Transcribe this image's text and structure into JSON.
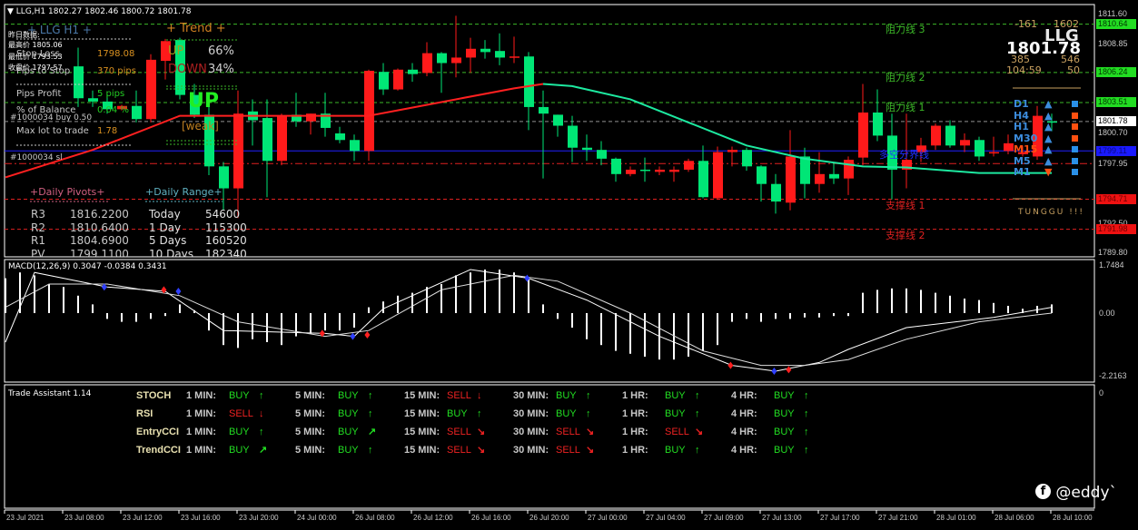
{
  "header": {
    "title": "LLG,H1",
    "ohlc": "1802.27 1802.46 1800.72 1801.78"
  },
  "colors": {
    "bull": "#00e676",
    "bear": "#ff1a1a",
    "ma_up": "#ff2020",
    "ma_down": "#1de9a0",
    "green_level": "#3cb828",
    "red_level": "#e02020",
    "blue_level": "#2020ff",
    "gray_level": "#909090"
  },
  "candles": [
    [
      1803.9,
      1808.5,
      1803.1,
      1806.8
    ],
    [
      1803.6,
      1804.6,
      1803.1,
      1803.9
    ],
    [
      1802.9,
      1804.2,
      1802.5,
      1803.6
    ],
    [
      1803.2,
      1803.3,
      1802.8,
      1802.9
    ],
    [
      1802.0,
      1804.6,
      1801.7,
      1803.2
    ],
    [
      1807.4,
      1807.9,
      1801.7,
      1802.0
    ],
    [
      1809.1,
      1809.3,
      1805.6,
      1807.3
    ],
    [
      1804.2,
      1809.4,
      1803.8,
      1809.2
    ],
    [
      1802.4,
      1805.2,
      1802.1,
      1804.2
    ],
    [
      1797.7,
      1804.0,
      1796.9,
      1802.4
    ],
    [
      1795.7,
      1798.1,
      1793.7,
      1797.7
    ],
    [
      1802.5,
      1804.6,
      1793.0,
      1795.7
    ],
    [
      1801.9,
      1803.8,
      1799.6,
      1802.7
    ],
    [
      1798.2,
      1803.8,
      1794.9,
      1802.1
    ],
    [
      1802.3,
      1802.5,
      1797.8,
      1798.2
    ],
    [
      1801.8,
      1804.4,
      1801.3,
      1802.4
    ],
    [
      1802.5,
      1802.5,
      1800.6,
      1801.8
    ],
    [
      1801.2,
      1804.4,
      1800.4,
      1802.5
    ],
    [
      1800.1,
      1801.3,
      1799.8,
      1800.7
    ],
    [
      1799.1,
      1800.6,
      1798.2,
      1800.1
    ],
    [
      1806.4,
      1806.5,
      1798.2,
      1799.1
    ],
    [
      1804.7,
      1807.1,
      1804.2,
      1806.3
    ],
    [
      1806.5,
      1806.6,
      1804.6,
      1804.7
    ],
    [
      1806.1,
      1807.1,
      1805.4,
      1806.5
    ],
    [
      1808.0,
      1809.0,
      1805.9,
      1806.2
    ],
    [
      1807.1,
      1808.1,
      1804.4,
      1808.0
    ],
    [
      1807.6,
      1811.4,
      1805.8,
      1807.1
    ],
    [
      1808.4,
      1809.4,
      1806.2,
      1807.6
    ],
    [
      1808.1,
      1809.2,
      1807.5,
      1808.4
    ],
    [
      1807.6,
      1809.8,
      1806.9,
      1808.2
    ],
    [
      1807.7,
      1809.5,
      1807.1,
      1807.6
    ],
    [
      1803.1,
      1808.1,
      1801.0,
      1807.7
    ],
    [
      1802.5,
      1804.6,
      1796.6,
      1803.1
    ],
    [
      1801.4,
      1802.4,
      1800.4,
      1802.4
    ],
    [
      1799.4,
      1802.3,
      1798.1,
      1801.4
    ],
    [
      1799.2,
      1800.6,
      1798.2,
      1799.4
    ],
    [
      1798.4,
      1800.0,
      1797.8,
      1799.2
    ],
    [
      1797.0,
      1798.5,
      1796.3,
      1798.4
    ],
    [
      1797.4,
      1797.7,
      1796.8,
      1797.0
    ],
    [
      1797.3,
      1798.5,
      1796.3,
      1797.4
    ],
    [
      1797.4,
      1797.7,
      1796.9,
      1797.2
    ],
    [
      1797.4,
      1797.7,
      1796.3,
      1797.2
    ],
    [
      1798.2,
      1798.4,
      1797.2,
      1797.4
    ],
    [
      1794.9,
      1799.6,
      1794.8,
      1798.2
    ],
    [
      1799.0,
      1799.5,
      1794.7,
      1794.8
    ],
    [
      1799.2,
      1799.5,
      1797.7,
      1799.0
    ],
    [
      1797.7,
      1799.4,
      1797.3,
      1799.2
    ],
    [
      1796.1,
      1797.8,
      1794.5,
      1797.7
    ],
    [
      1794.5,
      1797.0,
      1793.4,
      1796.1
    ],
    [
      1798.6,
      1801.0,
      1793.7,
      1794.4
    ],
    [
      1796.1,
      1799.4,
      1794.8,
      1798.6
    ],
    [
      1797.0,
      1799.0,
      1795.3,
      1796.1
    ],
    [
      1796.6,
      1798.0,
      1796.1,
      1797.0
    ],
    [
      1798.3,
      1798.6,
      1795.1,
      1796.6
    ],
    [
      1802.6,
      1805.2,
      1797.8,
      1798.5
    ],
    [
      1800.5,
      1804.7,
      1800.0,
      1802.6
    ],
    [
      1797.4,
      1802.5,
      1794.7,
      1800.5
    ],
    [
      1798.3,
      1802.5,
      1795.7,
      1797.4
    ],
    [
      1799.6,
      1800.3,
      1798.1,
      1799.0
    ],
    [
      1801.4,
      1801.6,
      1799.2,
      1799.6
    ],
    [
      1799.6,
      1801.9,
      1799.4,
      1801.4
    ],
    [
      1800.1,
      1800.7,
      1799.0,
      1799.6
    ],
    [
      1798.6,
      1800.4,
      1798.2,
      1800.1
    ],
    [
      1799.0,
      1800.4,
      1798.6,
      1798.9
    ],
    [
      1799.8,
      1800.6,
      1798.8,
      1799.1
    ],
    [
      1799.0,
      1799.6,
      1798.6,
      1798.8
    ],
    [
      1802.3,
      1803.2,
      1798.3,
      1798.6
    ],
    [
      1801.7,
      1802.5,
      1800.9,
      1801.8
    ]
  ],
  "ma": [
    [
      -5,
      1796.7
    ],
    [
      1,
      1799.2
    ],
    [
      7,
      1802.3
    ],
    [
      13,
      1802.3
    ],
    [
      20,
      1802.3
    ],
    [
      26,
      1803.8
    ],
    [
      30,
      1804.8
    ],
    [
      32,
      1805.2
    ],
    [
      34,
      1805.0
    ],
    [
      38,
      1803.8
    ],
    [
      42,
      1801.7
    ],
    [
      46,
      1799.6
    ],
    [
      50,
      1798.4
    ],
    [
      54,
      1797.7
    ],
    [
      57,
      1797.6
    ],
    [
      62,
      1797.1
    ],
    [
      67,
      1797.1
    ]
  ],
  "ma_turn_index": 33,
  "levels": [
    {
      "price": 1810.64,
      "color": "#3cb828",
      "style": "dash"
    },
    {
      "price": 1806.24,
      "color": "#3cb828",
      "style": "dash"
    },
    {
      "price": 1803.51,
      "color": "#3cb828",
      "style": "dash"
    },
    {
      "price": 1801.78,
      "color": "#909090",
      "style": "dash"
    },
    {
      "price": 1799.11,
      "color": "#2020ff",
      "style": "solid"
    },
    {
      "price": 1797.95,
      "color": "#e02020",
      "style": "dashdot"
    },
    {
      "price": 1794.71,
      "color": "#e02020",
      "style": "dash"
    },
    {
      "price": 1791.98,
      "color": "#e02020",
      "style": "dash"
    }
  ],
  "price_axis": [
    {
      "text": "1811.60",
      "price": 1811.6,
      "bg": "",
      "fg": "#c8c8c8"
    },
    {
      "text": "1810.64",
      "price": 1810.64,
      "bg": "#22dd22",
      "fg": "#003300"
    },
    {
      "text": "1808.85",
      "price": 1808.85,
      "bg": "",
      "fg": "#c8c8c8"
    },
    {
      "text": "1806.24",
      "price": 1806.24,
      "bg": "#22dd22",
      "fg": "#003300"
    },
    {
      "text": "1803.51",
      "price": 1803.51,
      "bg": "#22dd22",
      "fg": "#003300"
    },
    {
      "text": "1801.78",
      "price": 1801.78,
      "bg": "#ffffff",
      "fg": "#000000"
    },
    {
      "text": "1800.70",
      "price": 1800.7,
      "bg": "",
      "fg": "#c8c8c8"
    },
    {
      "text": "1799.11",
      "price": 1799.11,
      "bg": "#1a1aff",
      "fg": "#0a0a80"
    },
    {
      "text": "1797.95",
      "price": 1797.95,
      "bg": "",
      "fg": "#c8c8c8"
    },
    {
      "text": "1794.71",
      "price": 1794.71,
      "bg": "#ee1111",
      "fg": "#700000"
    },
    {
      "text": "1792.50",
      "price": 1792.5,
      "bg": "",
      "fg": "#c8c8c8"
    },
    {
      "text": "1791.98",
      "price": 1791.98,
      "bg": "#ee1111",
      "fg": "#700000"
    },
    {
      "text": "1789.80",
      "price": 1789.8,
      "bg": "",
      "fg": "#c8c8c8"
    }
  ],
  "left_panel": {
    "title": "+ LLG  H1 +",
    "yesterday_label": "昨日数据:",
    "high": "最高价 1805.06",
    "low": "最低价 1793.53",
    "close": "收盘价 1797.57",
    "rows": [
      {
        "label": "Stop Loss",
        "value": "1798.08"
      },
      {
        "label": "Pips to Stop",
        "value": "370 pips"
      },
      {
        "label": "Pips Profit",
        "value": "5 pips"
      },
      {
        "label": "% of Balance",
        "value": "0.04 %"
      },
      {
        "label": "Max lot to trade",
        "value": "1.78"
      }
    ]
  },
  "trend": {
    "title": "+  Trend  +",
    "up_label": "UP",
    "up_value": "66%",
    "down_label": "DOWN",
    "down_value": "34%",
    "signal": "UP",
    "strength": "[weak]"
  },
  "orders": {
    "buy": "#1000034 buy 0.50",
    "sl": "#1000034 sl"
  },
  "pivots": {
    "title": "+Daily Pivots+",
    "rows": [
      {
        "name": "R3",
        "value": "1816.2200"
      },
      {
        "name": "R2",
        "value": "1810.6400"
      },
      {
        "name": "R1",
        "value": "1804.6900"
      },
      {
        "name": "PV",
        "value": "1799.1100"
      }
    ]
  },
  "range": {
    "title": "+Daily Range+",
    "rows": [
      {
        "name": "Today",
        "value": "54600"
      },
      {
        "name": "1 Day",
        "value": "115300"
      },
      {
        "name": "5 Days",
        "value": "160520"
      },
      {
        "name": "10 Days",
        "value": "182340"
      }
    ]
  },
  "sr_labels": {
    "r3": "阻力线 3",
    "r2": "阻力线 2",
    "r1": "阻力线 1",
    "pivot": "多空分界线",
    "s1": "支撑线 1",
    "s2": "支撑线 2"
  },
  "info_box": {
    "a": "-161",
    "b": "1602",
    "symbol": "LLG",
    "price": "1801.78",
    "c": "385",
    "d": "546",
    "timer": "104:59",
    "e": "50",
    "status": "TUNGGU !!!",
    "tfs": [
      {
        "tf": "D1",
        "arrow": "up",
        "sq": "blue"
      },
      {
        "tf": "H4",
        "arrow": "up",
        "sq": "orange"
      },
      {
        "tf": "H1",
        "arrow": "up",
        "sq": "orange"
      },
      {
        "tf": "M30",
        "arrow": "up",
        "sq": "orange"
      },
      {
        "tf": "M15",
        "arrow": "up",
        "sq": "blue"
      },
      {
        "tf": "M5",
        "arrow": "up",
        "sq": "blue"
      },
      {
        "tf": "M1",
        "arrow": "down",
        "sq": "blue"
      }
    ]
  },
  "macd": {
    "label": "MACD(12,26,9) 0.3047 -0.0384 0.3431",
    "axis": [
      "1.7484",
      "0.00",
      "-2.2163"
    ],
    "hist_start_index": -5,
    "hist": [
      1.2,
      1.4,
      1.3,
      1.0,
      0.9,
      0.6,
      0.3,
      -0.2,
      -0.3,
      -0.3,
      -0.2,
      -0.1,
      0.3,
      0.1,
      -0.6,
      -1.1,
      -1.2,
      -0.9,
      -1.0,
      -1.1,
      -0.8,
      -0.7,
      -0.6,
      -0.6,
      -0.5,
      0.2,
      0.4,
      0.6,
      0.7,
      0.9,
      1.0,
      1.3,
      1.4,
      1.5,
      1.5,
      1.4,
      1.2,
      0.3,
      -0.2,
      -0.5,
      -0.9,
      -1.1,
      -1.3,
      -1.4,
      -1.5,
      -1.6,
      -1.6,
      -1.5,
      -1.3,
      -1.1,
      -0.3,
      -0.2,
      -0.3,
      -0.2,
      -0.2,
      -0.15,
      -0.15,
      -0.1,
      -0.1,
      0.7,
      0.8,
      0.85,
      0.85,
      0.8,
      0.7,
      0.6,
      0.5,
      0.45,
      0.35,
      0.25,
      0.15,
      0.25,
      0.3
    ],
    "line1": [
      [
        -5,
        -1.0
      ],
      [
        -3,
        1.4
      ],
      [
        2,
        0.9
      ],
      [
        6,
        0.75
      ],
      [
        10,
        -0.6
      ],
      [
        17,
        -0.7
      ],
      [
        19,
        -0.8
      ],
      [
        21,
        0.15
      ],
      [
        27,
        1.5
      ],
      [
        31,
        1.2
      ],
      [
        35,
        0.45
      ],
      [
        40,
        -0.8
      ],
      [
        45,
        -1.8
      ],
      [
        48,
        -2.0
      ],
      [
        51,
        -1.7
      ],
      [
        53,
        -1.25
      ],
      [
        57,
        -0.5
      ],
      [
        63,
        -0.15
      ],
      [
        67,
        0.2
      ]
    ],
    "line2": [
      [
        -5,
        0.2
      ],
      [
        -2,
        1.0
      ],
      [
        2,
        1.0
      ],
      [
        7,
        0.6
      ],
      [
        11,
        -0.3
      ],
      [
        17,
        -0.8
      ],
      [
        20,
        -0.6
      ],
      [
        25,
        0.8
      ],
      [
        30,
        1.3
      ],
      [
        33,
        1.1
      ],
      [
        38,
        0.0
      ],
      [
        43,
        -1.3
      ],
      [
        47,
        -1.8
      ],
      [
        50,
        -1.8
      ],
      [
        53,
        -1.6
      ],
      [
        57,
        -0.9
      ],
      [
        62,
        -0.3
      ],
      [
        67,
        0.0
      ]
    ],
    "markers": [
      [
        1.8,
        0.9,
        "#3040ff"
      ],
      [
        5.9,
        0.8,
        "#ff2020"
      ],
      [
        6.9,
        0.75,
        "#3040ff"
      ],
      [
        16.8,
        -0.7,
        "#ff2020"
      ],
      [
        18.9,
        -0.8,
        "#3040ff"
      ],
      [
        19.9,
        -0.75,
        "#ff2020"
      ],
      [
        30.9,
        1.2,
        "#3040ff"
      ],
      [
        44.9,
        -1.8,
        "#ff2020"
      ],
      [
        47.9,
        -2.0,
        "#3040ff"
      ],
      [
        48.9,
        -1.95,
        "#ff2020"
      ]
    ]
  },
  "trade_assistant": {
    "title": "Trade Assistant 1.14",
    "zero_label": "0",
    "timeframes": [
      "1 MIN:",
      "5 MIN:",
      "15 MIN:",
      "30 MIN:",
      "1 HR:",
      "4 HR:"
    ],
    "rows": [
      {
        "name": "STOCH",
        "signals": [
          [
            "BUY",
            "↑"
          ],
          [
            "BUY",
            "↑"
          ],
          [
            "SELL",
            "↓"
          ],
          [
            "BUY",
            "↑"
          ],
          [
            "BUY",
            "↑"
          ],
          [
            "BUY",
            "↑"
          ]
        ]
      },
      {
        "name": "RSI",
        "signals": [
          [
            "SELL",
            "↓"
          ],
          [
            "BUY",
            "↑"
          ],
          [
            "BUY",
            "↑"
          ],
          [
            "BUY",
            "↑"
          ],
          [
            "BUY",
            "↑"
          ],
          [
            "BUY",
            "↑"
          ]
        ]
      },
      {
        "name": "EntryCCI",
        "signals": [
          [
            "BUY",
            "↑"
          ],
          [
            "BUY",
            "↗"
          ],
          [
            "SELL",
            "↘"
          ],
          [
            "SELL",
            "↘"
          ],
          [
            "SELL",
            "↘"
          ],
          [
            "BUY",
            "↑"
          ]
        ]
      },
      {
        "name": "TrendCCI",
        "signals": [
          [
            "BUY",
            "↗"
          ],
          [
            "BUY",
            "↑"
          ],
          [
            "SELL",
            "↘"
          ],
          [
            "SELL",
            "↘"
          ],
          [
            "BUY",
            "↑"
          ],
          [
            "BUY",
            "↑"
          ]
        ]
      }
    ]
  },
  "time_axis": [
    "23 Jul 2021",
    "23 Jul 08:00",
    "23 Jul 12:00",
    "23 Jul 16:00",
    "23 Jul 20:00",
    "24 Jul 00:00",
    "26 Jul 08:00",
    "26 Jul 12:00",
    "26 Jul 16:00",
    "26 Jul 20:00",
    "27 Jul 00:00",
    "27 Jul 04:00",
    "27 Jul 09:00",
    "27 Jul 13:00",
    "27 Jul 17:00",
    "27 Jul 21:00",
    "28 Jul 01:00",
    "28 Jul 06:00",
    "28 Jul 10:00"
  ],
  "watermark": "@eddy`"
}
